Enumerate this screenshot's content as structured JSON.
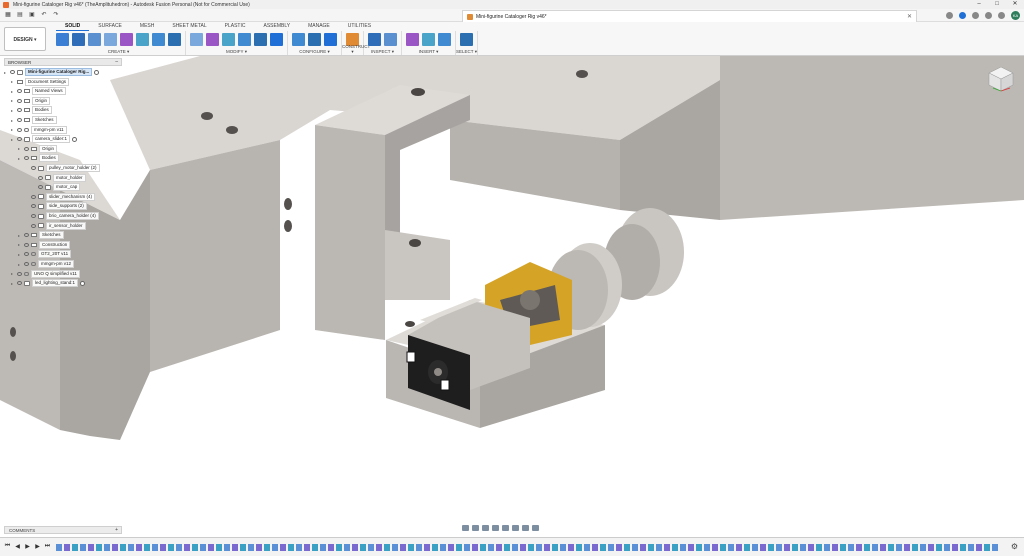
{
  "window": {
    "title": "Mini-figurine Cataloger Rig v46* (TheAmplituhedron) - Autodesk Fusion Personal (Not for Commercial Use)",
    "controls": [
      "–",
      "□",
      "✕"
    ]
  },
  "document_tab": {
    "label": "Mini-figurine Cataloger Rig v46*",
    "close": "✕"
  },
  "user": {
    "initials": "KA"
  },
  "workspace": {
    "label": "DESIGN ▾"
  },
  "ribbon_tabs": [
    {
      "label": "SOLID",
      "active": true
    },
    {
      "label": "SURFACE",
      "active": false
    },
    {
      "label": "MESH",
      "active": false
    },
    {
      "label": "SHEET METAL",
      "active": false
    },
    {
      "label": "PLASTIC",
      "active": false
    },
    {
      "label": "ASSEMBLY",
      "active": false
    },
    {
      "label": "MANAGE",
      "active": false
    },
    {
      "label": "UTILITIES",
      "active": false
    }
  ],
  "tool_groups": [
    {
      "label": "CREATE ▾",
      "tools": [
        "sketch",
        "extrude",
        "revolve",
        "sweep",
        "loft",
        "box",
        "mirror",
        "pattern"
      ]
    },
    {
      "label": "MODIFY ▾",
      "tools": [
        "press-pull",
        "fillet",
        "chamfer",
        "shell",
        "combine",
        "move"
      ]
    },
    {
      "label": "CONFIGURE ▾",
      "tools": [
        "configure-1",
        "configure-2",
        "configure-3"
      ]
    },
    {
      "label": "CONSTRUCT ▾",
      "tools": [
        "plane"
      ]
    },
    {
      "label": "INSPECT ▾",
      "tools": [
        "measure",
        "section"
      ]
    },
    {
      "label": "INSERT ▾",
      "tools": [
        "insert-derive",
        "insert-image",
        "insert-mesh"
      ]
    },
    {
      "label": "SELECT ▾",
      "tools": [
        "select"
      ]
    }
  ],
  "browser": {
    "title": "BROWSER",
    "items": [
      {
        "label": "Mini-figurine Cataloger Rig...",
        "type": "root",
        "depth": 0
      },
      {
        "label": "Document Settings",
        "type": "settings",
        "depth": 1
      },
      {
        "label": "Named Views",
        "type": "folder",
        "depth": 1
      },
      {
        "label": "Origin",
        "type": "folder",
        "depth": 1
      },
      {
        "label": "Bodies",
        "type": "folder",
        "depth": 1
      },
      {
        "label": "Sketches",
        "type": "folder",
        "depth": 1
      },
      {
        "label": "mmgm-pm v11",
        "type": "link",
        "depth": 1
      },
      {
        "label": "camera_slider:1",
        "type": "component",
        "depth": 1
      },
      {
        "label": "Origin",
        "type": "folder",
        "depth": 2
      },
      {
        "label": "Bodies",
        "type": "folder",
        "depth": 2
      },
      {
        "label": "pulley_motor_holder (2)",
        "type": "body",
        "depth": 3
      },
      {
        "label": "motor_holder",
        "type": "body",
        "depth": 4
      },
      {
        "label": "motor_cap",
        "type": "body",
        "depth": 4
      },
      {
        "label": "slider_mechanism (4)",
        "type": "body",
        "depth": 3
      },
      {
        "label": "side_supports (2)",
        "type": "body",
        "depth": 3
      },
      {
        "label": "brio_camera_holder (4)",
        "type": "body",
        "depth": 3
      },
      {
        "label": "ir_sensor_holder",
        "type": "body",
        "depth": 3
      },
      {
        "label": "Sketches",
        "type": "folder",
        "depth": 2
      },
      {
        "label": "Construction",
        "type": "folder",
        "depth": 2
      },
      {
        "label": "GT2_20T v11",
        "type": "link",
        "depth": 2
      },
      {
        "label": "mmgm-pm v12",
        "type": "link",
        "depth": 2
      },
      {
        "label": "UNO Q simplified v11",
        "type": "link",
        "depth": 1
      },
      {
        "label": "led_lighting_stand:1",
        "type": "component",
        "depth": 1
      }
    ]
  },
  "comments": {
    "title": "COMMENTS",
    "add": "+"
  },
  "colors": {
    "body_face_top": "#dedad6",
    "body_face_front": "#bab6b2",
    "body_face_side": "#a9a5a1",
    "motor_black": "#1e1e1e",
    "gear_gold": "#d5a326",
    "accent": "#1f6fd6"
  },
  "timeline": {
    "controls": [
      "⏮",
      "◀",
      "▶",
      "▶",
      "⏭"
    ],
    "gear": "⚙"
  }
}
